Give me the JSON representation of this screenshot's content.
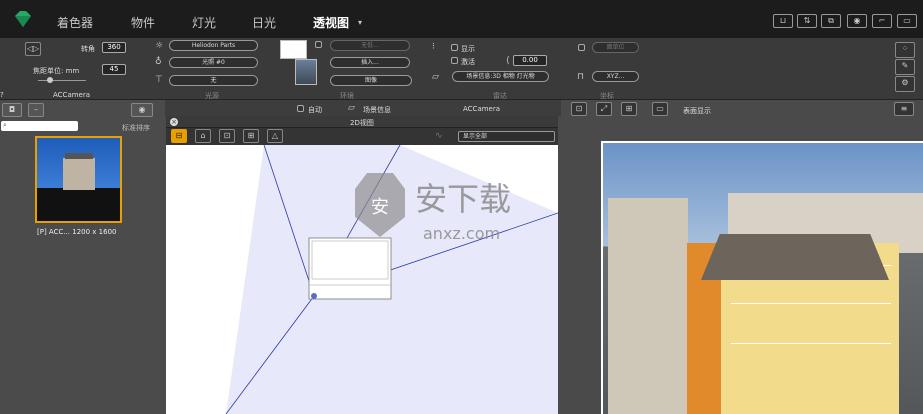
{
  "topbar": {
    "tabs": [
      "着色器",
      "物件",
      "灯光",
      "日光",
      "透视图"
    ],
    "active": "透视图",
    "dropdown": "▾",
    "right_icons": [
      "cart-icon",
      "share-icon",
      "window-icon",
      "camera-icon",
      "frame-icon",
      "frame2-icon"
    ]
  },
  "camera": {
    "rotation_label": "转角",
    "rotation_value": "360",
    "focal_label": "焦距单位: mm",
    "focal_value": "45",
    "name": "ACCamera",
    "help": "?"
  },
  "lens": {
    "preset": "Heliodon Parts",
    "light": "光照 #0",
    "none": "无",
    "section": "光源"
  },
  "environment": {
    "load_btn": "无低...",
    "insert_btn": "插入...",
    "image_select": "图像",
    "section": "环境"
  },
  "options": {
    "show": "显示",
    "activate": "激活",
    "value": "0.00",
    "scene_info": "场景信息:3D 相物 灯光物",
    "section": "雷达"
  },
  "coords": {
    "btn1": "面单位",
    "btn2": "XYZ...",
    "section": "坐标"
  },
  "bottomlabels": {
    "auto": "自动",
    "scene_info": "场景信息",
    "camera": "ACCamera",
    "realtime": "表面显示"
  },
  "leftpanel": {
    "sort_label": "标准排序",
    "thumb_caption": "[P] ACC... 1200 x 1600"
  },
  "window2d": {
    "title": "2D视图",
    "display_select": "显示全部"
  },
  "watermark": {
    "cn": "安下载",
    "url": "anxz.com"
  },
  "colors": {
    "accent": "#e8a000",
    "topbar": "#1c1c1c",
    "panel": "#3a3a3a",
    "fov": "#e8e8fb",
    "line": "#2a3aa0"
  }
}
